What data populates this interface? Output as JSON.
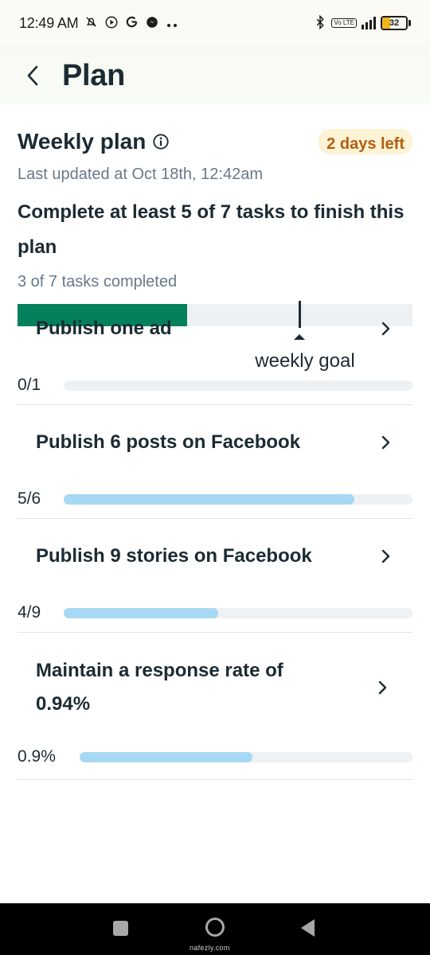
{
  "status_bar": {
    "time": "12:49 AM",
    "battery": "32",
    "battery_level": 0.32,
    "network": "4G",
    "volte": "Vo LTE"
  },
  "header": {
    "title": "Plan"
  },
  "plan": {
    "section_title": "Weekly plan",
    "days_left": "2 days left",
    "last_updated": "Last updated at Oct 18th, 12:42am",
    "goal_text": "Complete at least 5 of 7 tasks to finish this plan",
    "tasks_completed": "3 of 7 tasks completed",
    "completed_count": 3,
    "total_count": 7,
    "goal_count": 5,
    "goal_label": "weekly goal",
    "progress_color": "#04805d"
  },
  "tasks": [
    {
      "title": "Publish one ad",
      "count": "0/1",
      "progress": 0
    },
    {
      "title": "Publish 6 posts on Facebook",
      "count": "5/6",
      "progress": 0.833
    },
    {
      "title": "Publish 9 stories on Facebook",
      "count": "4/9",
      "progress": 0.444
    },
    {
      "title": "Maintain a response rate of 0.94%",
      "count": "0.9%",
      "progress": 0.52
    }
  ],
  "watermark": "nafezly.com"
}
